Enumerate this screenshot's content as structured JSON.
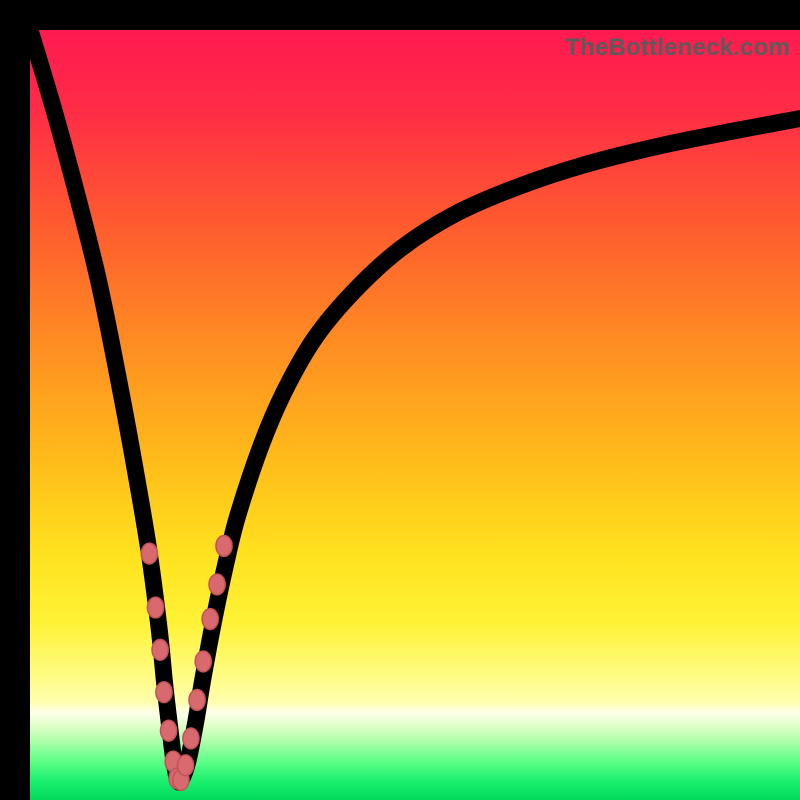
{
  "watermark": "TheBottleneck.com",
  "background": {
    "frame_color": "#000000",
    "gradient_stops": [
      {
        "offset": 0.0,
        "color": "#ff1a50"
      },
      {
        "offset": 0.1,
        "color": "#ff2b47"
      },
      {
        "offset": 0.25,
        "color": "#ff5a2f"
      },
      {
        "offset": 0.4,
        "color": "#ff8a23"
      },
      {
        "offset": 0.55,
        "color": "#ffb91a"
      },
      {
        "offset": 0.68,
        "color": "#ffe11e"
      },
      {
        "offset": 0.77,
        "color": "#fff236"
      },
      {
        "offset": 0.83,
        "color": "#fffb7a"
      },
      {
        "offset": 0.874,
        "color": "#ffffb0"
      },
      {
        "offset": 0.882,
        "color": "#ffffd9"
      },
      {
        "offset": 0.888,
        "color": "#fbffe8"
      },
      {
        "offset": 0.9,
        "color": "#e6ffcf"
      },
      {
        "offset": 0.92,
        "color": "#b8ffaf"
      },
      {
        "offset": 0.95,
        "color": "#5dff87"
      },
      {
        "offset": 0.975,
        "color": "#1cf06e"
      },
      {
        "offset": 1.0,
        "color": "#00d85c"
      }
    ]
  },
  "chart_data": {
    "type": "line",
    "title": "",
    "xlabel": "",
    "ylabel": "",
    "xlim": [
      0,
      100
    ],
    "ylim": [
      0,
      100
    ],
    "grid": false,
    "note": "x is normalized 0–100 along horizontal axis; y is normalized 0–100 where 0=bottom, 100=top. Curve is V-shaped with minimum near x≈19.",
    "series": [
      {
        "name": "bottleneck-curve",
        "x": [
          0,
          3,
          6,
          9,
          12,
          14,
          15.5,
          16.8,
          17.5,
          18.2,
          18.7,
          19.2,
          19.7,
          20.5,
          21.5,
          22.5,
          24,
          25.5,
          27,
          30,
          33,
          37,
          42,
          48,
          55,
          63,
          72,
          82,
          92,
          100
        ],
        "y": [
          100,
          90,
          79,
          67,
          52,
          41,
          32,
          22,
          15,
          9,
          5,
          2.5,
          2.7,
          5,
          10,
          16,
          24,
          31,
          37,
          46,
          53,
          60,
          66,
          71.5,
          76,
          79.5,
          82.5,
          85,
          87,
          88.5
        ]
      }
    ],
    "markers": {
      "name": "highlighted-points",
      "color": "#d86a6f",
      "points": [
        {
          "x": 15.5,
          "y": 32
        },
        {
          "x": 16.3,
          "y": 25
        },
        {
          "x": 16.9,
          "y": 19.5
        },
        {
          "x": 17.4,
          "y": 14
        },
        {
          "x": 18.0,
          "y": 9
        },
        {
          "x": 18.6,
          "y": 5
        },
        {
          "x": 19.1,
          "y": 2.8
        },
        {
          "x": 19.6,
          "y": 2.6
        },
        {
          "x": 20.2,
          "y": 4.5
        },
        {
          "x": 20.9,
          "y": 8
        },
        {
          "x": 21.7,
          "y": 13
        },
        {
          "x": 22.5,
          "y": 18
        },
        {
          "x": 23.4,
          "y": 23.5
        },
        {
          "x": 24.3,
          "y": 28
        },
        {
          "x": 25.2,
          "y": 33
        }
      ]
    }
  }
}
